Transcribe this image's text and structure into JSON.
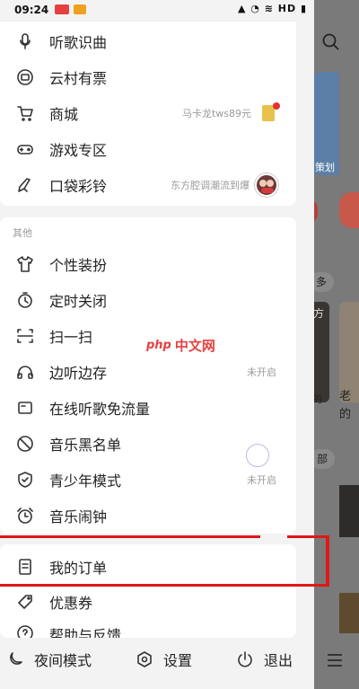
{
  "status_bar": {
    "time": "09:24",
    "right": "HD"
  },
  "menu_top": [
    {
      "label": "听歌识曲",
      "icon": "mic-icon"
    },
    {
      "label": "云村有票",
      "icon": "ticket-icon"
    },
    {
      "label": "商城",
      "icon": "cart-icon",
      "extra": "马卡龙tws89元"
    },
    {
      "label": "游戏专区",
      "icon": "gamepad-icon"
    },
    {
      "label": "口袋彩铃",
      "icon": "phone-bell-icon",
      "extra": "东方腔调潮流到爆"
    }
  ],
  "section_other": "其他",
  "menu_other": [
    {
      "label": "个性装扮",
      "icon": "shirt-icon"
    },
    {
      "label": "定时关闭",
      "icon": "timer-icon"
    },
    {
      "label": "扫一扫",
      "icon": "scan-icon"
    },
    {
      "label": "边听边存",
      "icon": "headphones-icon",
      "extra": "未开启"
    },
    {
      "label": "在线听歌免流量",
      "icon": "sim-card-icon"
    },
    {
      "label": "音乐黑名单",
      "icon": "block-icon"
    },
    {
      "label": "青少年模式",
      "icon": "shield-check-icon",
      "extra": "未开启"
    },
    {
      "label": "音乐闹钟",
      "icon": "alarm-clock-icon"
    }
  ],
  "menu_bottom": [
    {
      "label": "我的订单",
      "icon": "order-icon"
    },
    {
      "label": "优惠券",
      "icon": "coupon-icon"
    },
    {
      "label": "帮助与反馈",
      "icon": "help-icon"
    }
  ],
  "bottom_bar": {
    "night": "夜间模式",
    "settings": "设置",
    "logout": "退出"
  },
  "background_app": {
    "more": "多",
    "banner": "策划",
    "card_text1": "方",
    "caption1": "的",
    "caption2": "老的",
    "bu": "部"
  },
  "watermark": {
    "php": "php",
    "cn": "中文网"
  },
  "colors": {
    "accent_red": "#e01818",
    "drawer_bg": "#f3f3f3",
    "card_bg": "#ffffff"
  }
}
